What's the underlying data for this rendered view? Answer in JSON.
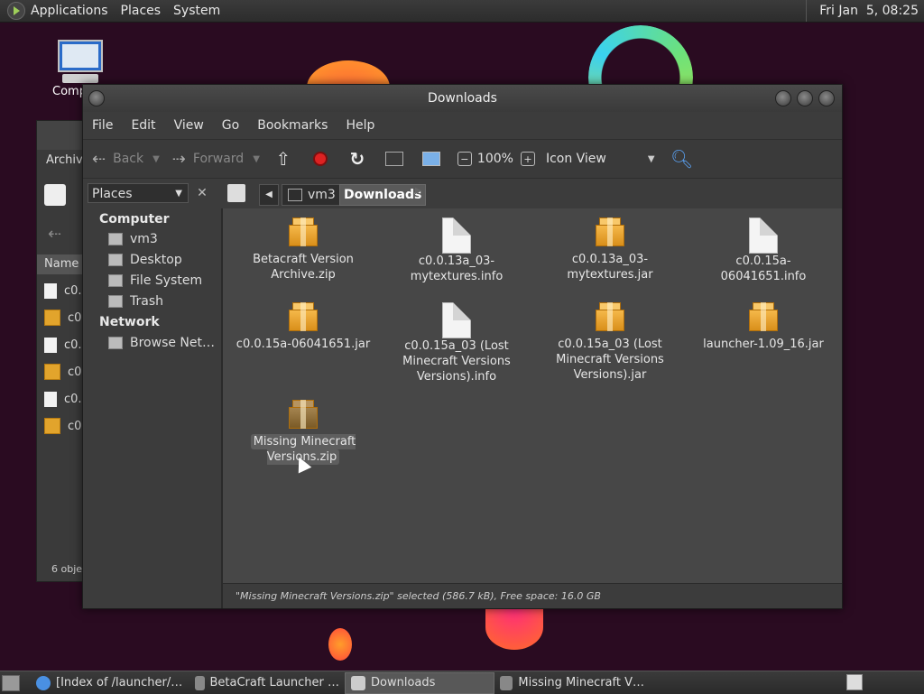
{
  "top_panel": {
    "menus": [
      "Applications",
      "Places",
      "System"
    ],
    "clock": "Fri Jan  5, 08:25"
  },
  "desktop": {
    "computer_label": "Comp"
  },
  "bg_window": {
    "title": "Archive",
    "column": "Name",
    "rows": [
      "c0.",
      "c0.",
      "c0.",
      "c0.",
      "c0.",
      "c0."
    ],
    "status": "6 objec"
  },
  "window": {
    "title": "Downloads",
    "menu": [
      "File",
      "Edit",
      "View",
      "Go",
      "Bookmarks",
      "Help"
    ],
    "toolbar": {
      "back": "Back",
      "forward": "Forward",
      "zoom": "100%",
      "view": "Icon View"
    },
    "location": {
      "places": "Places",
      "crumbs": [
        "vm3",
        "Downloads"
      ]
    },
    "sidebar": {
      "computer_header": "Computer",
      "computer_items": [
        "vm3",
        "Desktop",
        "File System",
        "Trash"
      ],
      "network_header": "Network",
      "network_items": [
        "Browse Net…"
      ]
    },
    "files": [
      {
        "name": "Betacraft Version Archive.zip",
        "kind": "package"
      },
      {
        "name": "c0.0.13a_03-mytextures.info",
        "kind": "doc"
      },
      {
        "name": "c0.0.13a_03-mytextures.jar",
        "kind": "package"
      },
      {
        "name": "c0.0.15a-06041651.info",
        "kind": "doc"
      },
      {
        "name": "c0.0.15a-06041651.jar",
        "kind": "package"
      },
      {
        "name": "c0.0.15a_03 (Lost Minecraft Versions Versions).info",
        "kind": "doc"
      },
      {
        "name": "c0.0.15a_03 (Lost Minecraft Versions Versions).jar",
        "kind": "package"
      },
      {
        "name": "launcher-1.09_16.jar",
        "kind": "package"
      },
      {
        "name": "Missing Minecraft Versions.zip",
        "kind": "package",
        "selected": true
      }
    ],
    "status": "\"Missing Minecraft Versions.zip\" selected (586.7 kB), Free space: 16.0 GB"
  },
  "taskbar": {
    "tasks": [
      "[Index of /launcher/…",
      "BetaCraft Launcher …",
      "Downloads",
      "Missing Minecraft V…"
    ],
    "active_index": 2
  }
}
